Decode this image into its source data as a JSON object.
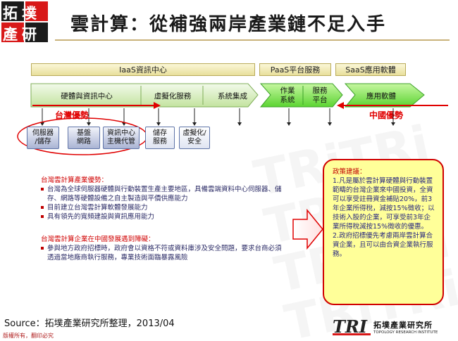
{
  "logo": {
    "line1": "拓墣",
    "line2": "產研"
  },
  "title": "雲計算：從補強兩岸產業鏈不足入手",
  "header_bars": {
    "iaas": "IaaS資訊中心",
    "paas": "PaaS平台服務",
    "saas": "SaaS應用軟體"
  },
  "green_segments": {
    "hw_dc": "硬體與資訊中心",
    "virtual": "虛擬化服務",
    "integration": "系統集成",
    "ops_line1": "作業",
    "ops_line2": "系統",
    "service_line1": "服務",
    "service_line2": "平台",
    "app": "應用軟體"
  },
  "labels": {
    "taiwan": "台灣優勢",
    "china": "中國優勢"
  },
  "sub_boxes": [
    {
      "line1": "伺服器",
      "line2": "/儲存"
    },
    {
      "line1": "基盤",
      "line2": "網路"
    },
    {
      "line1": "資訊中心",
      "line2": "主機代管"
    },
    {
      "line1": "儲存",
      "line2": "服務"
    },
    {
      "line1": "虛擬化/",
      "line2": "安全"
    }
  ],
  "tw_advantages": {
    "heading": "台灣雲計算產業優勢：",
    "items": [
      "台灣為全球伺服器硬體與行動裝置生產主要地區，具備雲端資料中心伺服器、儲存、網路等硬體設備之自主製造與平價供應能力",
      "目前建立台灣雲計算軟體發展能力",
      "具有領先的寬頻建設與資訊應用能力"
    ]
  },
  "tw_barriers": {
    "heading": "台灣雲計算企業在中國發展遇到障礙：",
    "items": [
      "參與地方政府招標時，政府會以資格不符或資料庫涉及安全問題，要求台商必須透過當地廠商執行服務，專業技術面臨暴露風險"
    ]
  },
  "policy": {
    "heading": "政策建議：",
    "body1": "1.凡是屬於雲計算硬體與行動裝置範疇的台灣企業來中國投資，全資可以享受註冊資金補貼20%，前3年企業所得稅，減按15%徵收；以技術入股的企業，可享受前3年企業所得稅減按15%徵收的優惠。",
    "body2": "2.政府招標優先考慮兩岸雲計算合資企業，且可以由合資企業執行服務。"
  },
  "source": "Source：拓墣產業研究所整理，2013/04",
  "copyright": "版權所有，翻印必究",
  "footer_logo": {
    "mark": "TRI",
    "cn": "拓墣產業研究所",
    "en": "TOPOLOGY RESEARCH INSTITUTE"
  },
  "colors": {
    "red": "#e00000",
    "green": "#63d63a",
    "policy_bg": "#ffff99"
  }
}
